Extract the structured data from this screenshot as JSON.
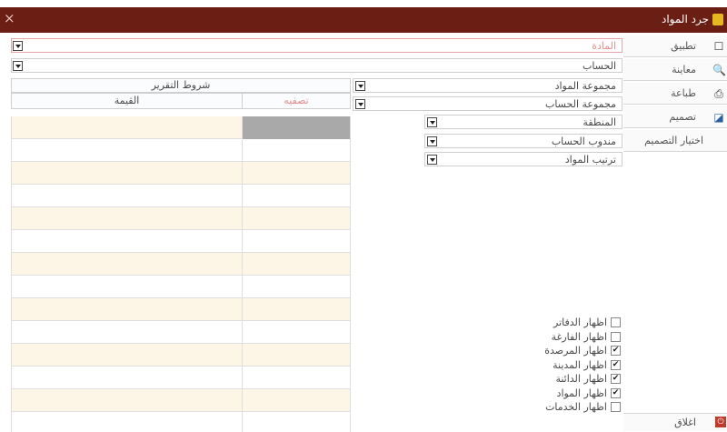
{
  "window": {
    "title": "جرد المواد",
    "close_glyph": "×"
  },
  "sidebar": {
    "apply": {
      "label": "تطبيق",
      "icon": "apply-icon"
    },
    "preview": {
      "label": "معاينة",
      "icon": "preview-icon"
    },
    "print": {
      "label": "طباعة",
      "icon": "print-icon"
    },
    "design": {
      "label": "تصميم",
      "icon": "design-icon"
    },
    "choose_design": {
      "label": "اختيار التصميم"
    },
    "close": {
      "label": "اغلاق",
      "icon": "close-icon"
    }
  },
  "fields": {
    "material": "المادة",
    "account": "الحساب",
    "material_group": "مجموعة المواد",
    "account_group": "مجموعة الحساب",
    "region": "المنطقة",
    "account_rep": "مندوب الحساب",
    "material_sort": "ترتيب المواد"
  },
  "table": {
    "report_conditions": "شروط التقرير",
    "col_value": "القيمة",
    "col_classification": "تصفيه",
    "row_count": 14
  },
  "checkboxes": [
    {
      "label": "اظهار الدفاتر",
      "checked": false
    },
    {
      "label": "اظهار الفارغة",
      "checked": false
    },
    {
      "label": "اظهار المرصدة",
      "checked": true
    },
    {
      "label": "اظهار المدينة",
      "checked": true
    },
    {
      "label": "اظهار الدائنة",
      "checked": true
    },
    {
      "label": "اظهار المواد",
      "checked": true
    },
    {
      "label": "اظهار الخدمات",
      "checked": false
    }
  ],
  "colors": {
    "titlebar": "#6b1f14",
    "row_alt": "#fdf6e6",
    "accent_pink": "#e38f8f"
  }
}
